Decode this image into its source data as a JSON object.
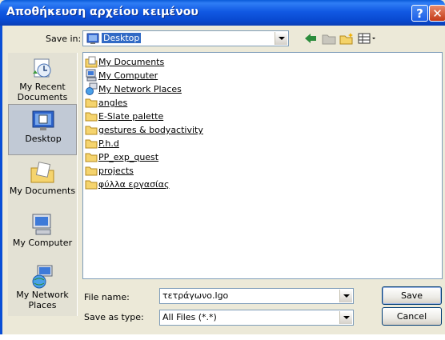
{
  "window": {
    "title": "Αποθήκευση αρχείου κειμένου",
    "help_glyph": "?",
    "close_glyph": "✕"
  },
  "save_in": {
    "label": "Save in:",
    "value": "Desktop"
  },
  "places": [
    {
      "label": "My Recent Documents",
      "icon": "recent-documents-icon"
    },
    {
      "label": "Desktop",
      "icon": "desktop-icon",
      "active": true
    },
    {
      "label": "My Documents",
      "icon": "my-documents-icon"
    },
    {
      "label": "My Computer",
      "icon": "my-computer-icon"
    },
    {
      "label": "My Network Places",
      "icon": "network-places-icon"
    }
  ],
  "files": [
    {
      "name": "My Documents",
      "icon": "my-documents-icon"
    },
    {
      "name": "My Computer",
      "icon": "my-computer-icon"
    },
    {
      "name": "My Network Places",
      "icon": "network-places-icon"
    },
    {
      "name": "angles",
      "icon": "folder-icon"
    },
    {
      "name": "E-Slate palette",
      "icon": "folder-icon"
    },
    {
      "name": "gestures & bodyactivity",
      "icon": "folder-icon"
    },
    {
      "name": "P.h.d",
      "icon": "folder-icon"
    },
    {
      "name": "PP_exp_quest",
      "icon": "folder-icon"
    },
    {
      "name": "projects",
      "icon": "folder-icon"
    },
    {
      "name": "φύλλα εργασίας",
      "icon": "folder-icon"
    }
  ],
  "file_name": {
    "label": "File name:",
    "value": "τετράγωνο.lgo"
  },
  "save_type": {
    "label": "Save as type:",
    "value": "All Files (*.*)"
  },
  "buttons": {
    "save": "Save",
    "cancel": "Cancel"
  },
  "colors": {
    "title_bar": "#0a4fd6",
    "selection": "#316ac5",
    "dialog_bg": "#ece9d8"
  }
}
